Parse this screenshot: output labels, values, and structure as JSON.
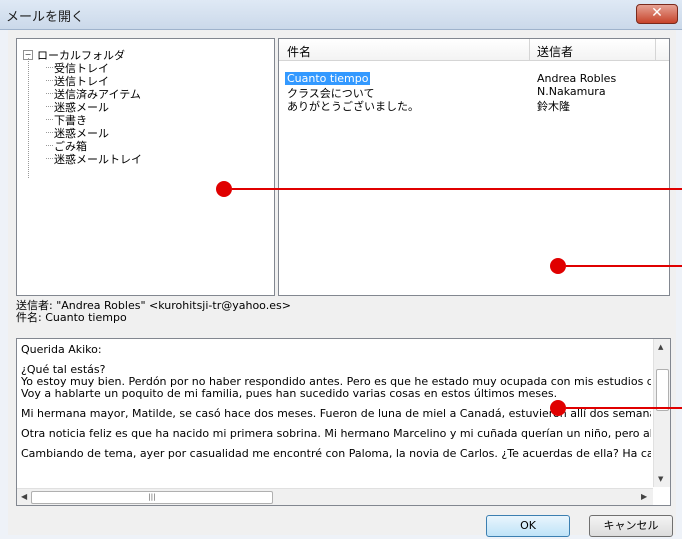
{
  "window": {
    "title": "メールを開く",
    "close_label": "✕"
  },
  "folder_tree": {
    "root": "ローカルフォルダ",
    "items": [
      "受信トレイ",
      "送信トレイ",
      "送信済みアイテム",
      "迷惑メール",
      "下書き",
      "迷惑メール",
      "ごみ箱",
      "迷惑メールトレイ"
    ]
  },
  "message_list": {
    "columns": {
      "subject": "件名",
      "sender": "送信者"
    },
    "rows": [
      {
        "subject": "Cuanto tiempo",
        "sender": "Andrea Robles"
      },
      {
        "subject": "クラス会について",
        "sender": "N.Nakamura"
      },
      {
        "subject": "ありがとうございました。",
        "sender": "鈴木隆"
      }
    ]
  },
  "header_info": {
    "from_line": "送信者: \"Andrea Robles\" <kurohitsji-tr@yahoo.es>",
    "subject_line": "件名: Cuanto tiempo"
  },
  "body": {
    "greeting": "Querida Akiko:",
    "p1": "¿Qué tal estás?",
    "p2": "Yo estoy muy bien.  Perdón por no haber respondido antes.  Pero es que he estado muy ocupada con mis estudios durante l",
    "p3": "Voy a hablarte un poquito de mi familia, pues han sucedido varias cosas en estos últimos meses.",
    "p4": "Mi hermana mayor, Matilde, se casó hace dos meses.  Fueron de luna de miel a Canadá, estuvieron allí dos semanas.  Alqui",
    "p5": "Otra noticia feliz es que ha nacido mi primera sobrina.  Mi hermano Marcelino y mi cuñada querían un niño, pero ahora estár",
    "p6": "Cambiando de tema, ayer por casualidad me encontré con Paloma, la novia de Carlos. ¿Te acuerdas de ella?  Ha cambiado r"
  },
  "buttons": {
    "ok": "OK",
    "cancel": "キャンセル"
  },
  "accent_colors": {
    "selection": "#3399ff",
    "annotation": "#e00000",
    "close": "#c7442b"
  }
}
